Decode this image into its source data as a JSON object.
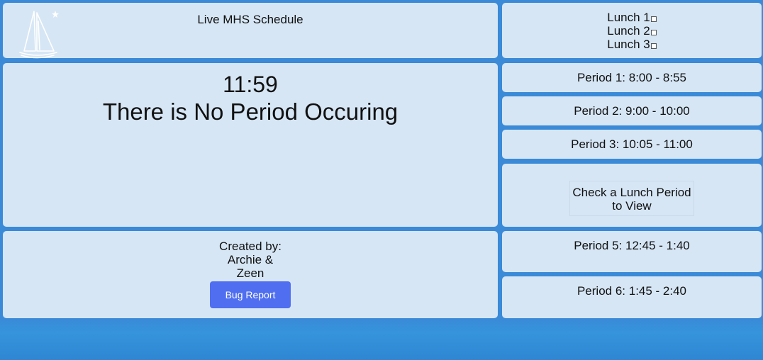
{
  "header": {
    "title": "Live MHS Schedule",
    "logo_icon": "sailboat-icon"
  },
  "main": {
    "time": "11:59",
    "status": "There is No Period Occuring"
  },
  "credits": {
    "line1": "Created by:",
    "line2": "Archie &",
    "line3": "Zeen",
    "bug_report_label": "Bug Report"
  },
  "lunch_select": {
    "items": [
      {
        "label": "Lunch 1",
        "checked": false
      },
      {
        "label": "Lunch 2",
        "checked": false
      },
      {
        "label": "Lunch 3",
        "checked": false
      }
    ]
  },
  "periods": {
    "p1": "Period 1: 8:00 - 8:55",
    "p2": "Period 2: 9:00 - 10:00",
    "p3": "Period 3: 10:05 - 11:00",
    "lunch_prompt_line1": "Check a Lunch Period",
    "lunch_prompt_line2": "to View",
    "p5": "Period 5: 12:45 - 1:40",
    "p6": "Period 6: 1:45 - 2:40"
  },
  "colors": {
    "background": "#3a8ad8",
    "panel": "#d6e6f5",
    "button": "#4f6ef0"
  }
}
